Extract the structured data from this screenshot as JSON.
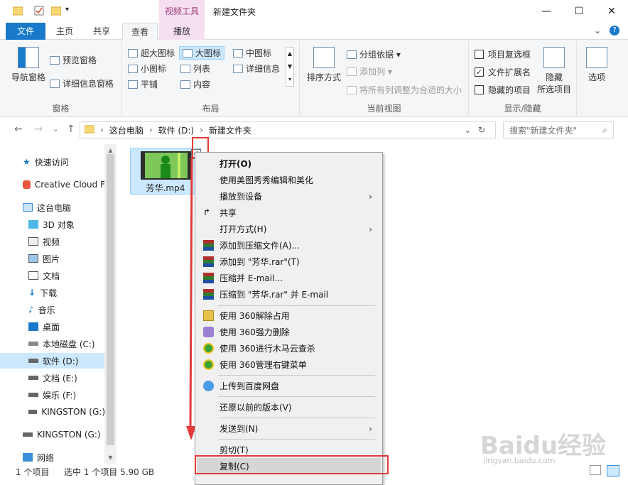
{
  "window": {
    "title": "新建文件夹",
    "context_tab_group": "视频工具"
  },
  "tabs": {
    "file": "文件",
    "home": "主页",
    "share": "共享",
    "view": "查看",
    "play": "播放"
  },
  "ribbon": {
    "pane_group": {
      "nav_pane": "导航窗格",
      "preview_pane": "预览窗格",
      "details_pane": "详细信息窗格",
      "label": "窗格"
    },
    "layout_group": {
      "items": [
        "超大图标",
        "大图标",
        "中图标",
        "小图标",
        "列表",
        "详细信息",
        "平铺",
        "内容"
      ],
      "label": "布局"
    },
    "current_view_group": {
      "sort_by": "排序方式",
      "group_by": "分组依据",
      "add_column": "添加列",
      "fit_columns": "将所有列调整为合适的大小",
      "label": "当前视图"
    },
    "show_hide_group": {
      "item_checkbox": "项目复选框",
      "file_ext": "文件扩展名",
      "hidden_items": "隐藏的项目",
      "hide_selected_line1": "隐藏",
      "hide_selected_line2": "所选项目",
      "label": "显示/隐藏"
    },
    "options": "选项"
  },
  "address": {
    "crumbs": [
      "这台电脑",
      "软件 (D:)",
      "新建文件夹"
    ],
    "search_placeholder": "搜索\"新建文件夹\""
  },
  "nav": {
    "items": [
      "快速访问",
      "Creative Cloud F",
      "这台电脑",
      "3D 对象",
      "视频",
      "图片",
      "文档",
      "下载",
      "音乐",
      "桌面",
      "本地磁盘 (C:)",
      "软件 (D:)",
      "文档 (E:)",
      "娱乐 (F:)",
      "KINGSTON (G:)",
      "KINGSTON (G:)",
      "网络"
    ]
  },
  "file": {
    "name": "芳华.mp4"
  },
  "status": {
    "count": "1 个项目",
    "selected": "选中 1 个项目  5.90 GB"
  },
  "menu": {
    "open": "打开(O)",
    "meitu": "使用美图秀秀编辑和美化",
    "cast": "播放到设备",
    "share": "共享",
    "open_with": "打开方式(H)",
    "add_archive": "添加到压缩文件(A)...",
    "add_rar": "添加到 \"芳华.rar\"(T)",
    "zip_email": "压缩并 E-mail...",
    "zip_rar_email": "压缩到 \"芳华.rar\" 并 E-mail",
    "unlock360": "使用 360解除占用",
    "delete360": "使用 360强力删除",
    "scan360": "使用 360进行木马云查杀",
    "manage360": "使用 360管理右键菜单",
    "baidu": "上传到百度网盘",
    "restore": "还原以前的版本(V)",
    "sendto": "发送到(N)",
    "cut": "剪切(T)",
    "copy": "复制(C)"
  },
  "watermark": {
    "brand": "Baidu经验",
    "url": "jingyan.baidu.com"
  },
  "colors": {
    "accent": "#1979ca",
    "selection": "#cce8ff",
    "context_tab": "#f6dff0",
    "annotation": "#e23a3a"
  }
}
